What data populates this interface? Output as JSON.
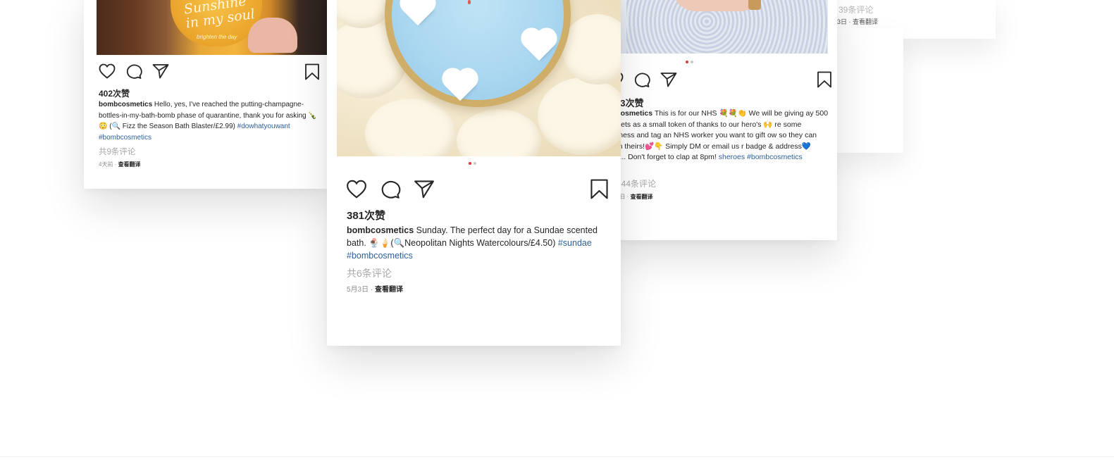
{
  "back_cards": [
    {
      "comments": "39条评论",
      "meta": "3日 · 查看翻译"
    }
  ],
  "posts": {
    "left": {
      "likes": "402次赞",
      "username": "bombcosmetics",
      "caption": " Hello, yes, I've reached the putting-champagne-bottles-in-my-bath-bomb phase of quarantine, thank you for asking 🍾😳 (🔍 Fizz the Season Bath Blaster/£2.99) ",
      "hashtags": "#dowhatyouwant #bombcosmetics",
      "comments": "共9条评论",
      "date": "4天前",
      "translate": "查看翻译",
      "photo_text": "Sunshine in my soul",
      "photo_subtext": "brighten the day",
      "dots": 2,
      "active_dot": 0
    },
    "center": {
      "likes": "381次赞",
      "username": "bombcosmetics",
      "caption": " Sunday. The perfect day for a Sundae scented bath. 🍨🍦(🔍Neopolitan Nights Watercolours/£4.50) ",
      "hashtags": "#sundae #bombcosmetics",
      "comments": "共6条评论",
      "date": "5月3日",
      "translate": "查看翻译",
      "dots": 2,
      "active_dot": 0
    },
    "right": {
      "likes": "93次赞",
      "username": "mbcosmetics",
      "caption": " This is for our NHS 💐💐👏 We will be giving ay 500 gift sets as a small token of thanks to our hero's 🙌 re some kindness and tag an NHS worker you want to gift ow so they can claim theirs!💕👇 Simply DM or email us r badge & address💙 Psst... Don't forget to clap at 8pm! ",
      "hashtags": "sheroes #bombcosmetics",
      "comments": "644条评论",
      "date": "3日",
      "translate": "查看翻译",
      "dots": 2,
      "active_dot": 0
    }
  },
  "colors": {
    "accent_dot": "#e53935",
    "hashtag": "#2d5f99",
    "text": "#262626",
    "muted": "#a8a8a8"
  },
  "icons": [
    "heart-icon",
    "comment-icon",
    "share-icon",
    "bookmark-icon"
  ]
}
